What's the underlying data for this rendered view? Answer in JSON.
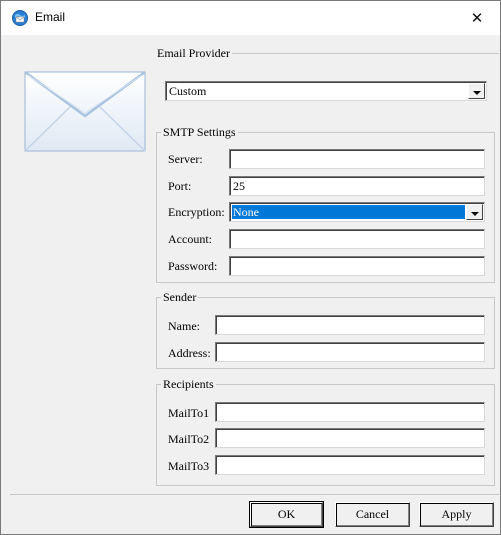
{
  "window": {
    "title": "Email",
    "close_glyph": "✕"
  },
  "icons": {
    "app": "globe-mail-icon",
    "envelope": "envelope-illustration",
    "dropdown": "chevron-down-icon"
  },
  "email_provider": {
    "group_label": "Email Provider",
    "selected": "Custom"
  },
  "smtp": {
    "group_label": "SMTP Settings",
    "server_label": "Server:",
    "server_value": "",
    "port_label": "Port:",
    "port_value": "25",
    "encryption_label": "Encryption:",
    "encryption_selected": "None",
    "account_label": "Account:",
    "account_value": "",
    "password_label": "Password:",
    "password_value": ""
  },
  "sender": {
    "group_label": "Sender",
    "name_label": "Name:",
    "name_value": "",
    "address_label": "Address:",
    "address_value": ""
  },
  "recipients": {
    "group_label": "Recipients",
    "mailto1_label": "MailTo1",
    "mailto1_value": "",
    "mailto2_label": "MailTo2",
    "mailto2_value": "",
    "mailto3_label": "MailTo3",
    "mailto3_value": ""
  },
  "buttons": {
    "ok": "OK",
    "cancel": "Cancel",
    "apply": "Apply"
  },
  "colors": {
    "selection": "#0078d7",
    "dialog_bg": "#f0f0f0"
  }
}
